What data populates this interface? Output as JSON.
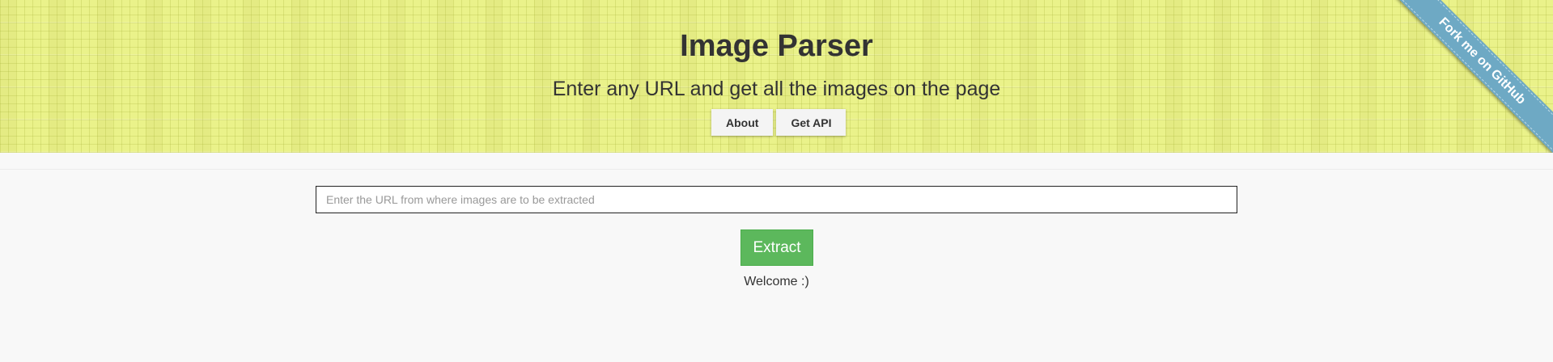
{
  "header": {
    "title": "Image Parser",
    "subtitle": "Enter any URL and get all the images on the page",
    "buttons": [
      {
        "label": "About"
      },
      {
        "label": "Get API"
      }
    ],
    "background_color": "#eaf28a"
  },
  "ribbon": {
    "label": "Fork me on GitHub",
    "color": "#6ea9c4"
  },
  "form": {
    "url_placeholder": "Enter the URL from where images are to be extracted",
    "url_value": "",
    "extract_label": "Extract",
    "extract_color": "#5cb85c"
  },
  "status": {
    "message": "Welcome :)"
  }
}
